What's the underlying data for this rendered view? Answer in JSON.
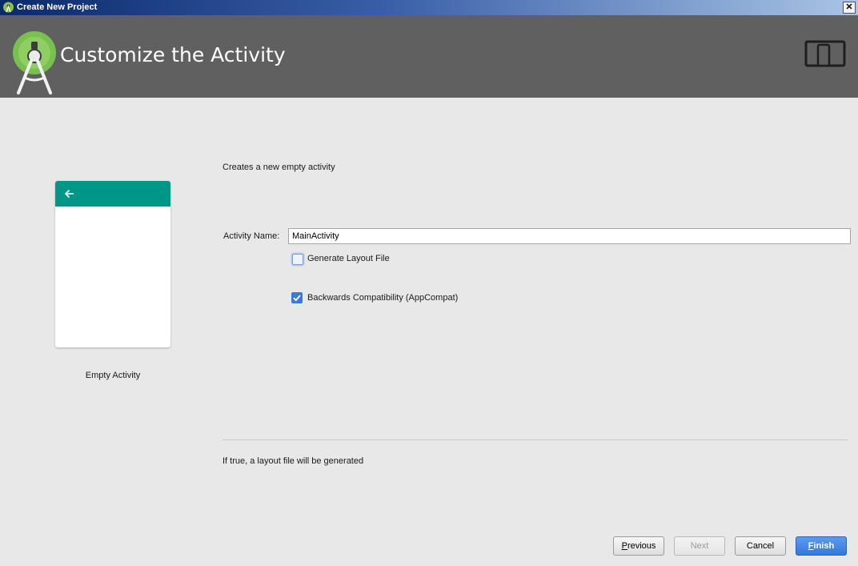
{
  "window": {
    "title": "Create New Project",
    "close_glyph": "✕"
  },
  "header": {
    "heading": "Customize the Activity",
    "logo_icon": "android-studio-logo-icon",
    "device_icon": "tablet-phone-icon"
  },
  "preview": {
    "label": "Empty Activity",
    "appbar_color": "#009688"
  },
  "form": {
    "description": "Creates a new empty activity",
    "activity_name_label": "Activity Name:",
    "activity_name_value": "MainActivity",
    "generate_layout_label": "Generate Layout File",
    "generate_layout_checked": false,
    "backwards_compat_label": "Backwards Compatibility (AppCompat)",
    "backwards_compat_checked": true
  },
  "hint": "If true, a layout file will be generated",
  "buttons": {
    "previous": {
      "first": "P",
      "rest": "revious"
    },
    "next": "Next",
    "cancel": "Cancel",
    "finish": {
      "first": "F",
      "rest": "inish"
    }
  }
}
